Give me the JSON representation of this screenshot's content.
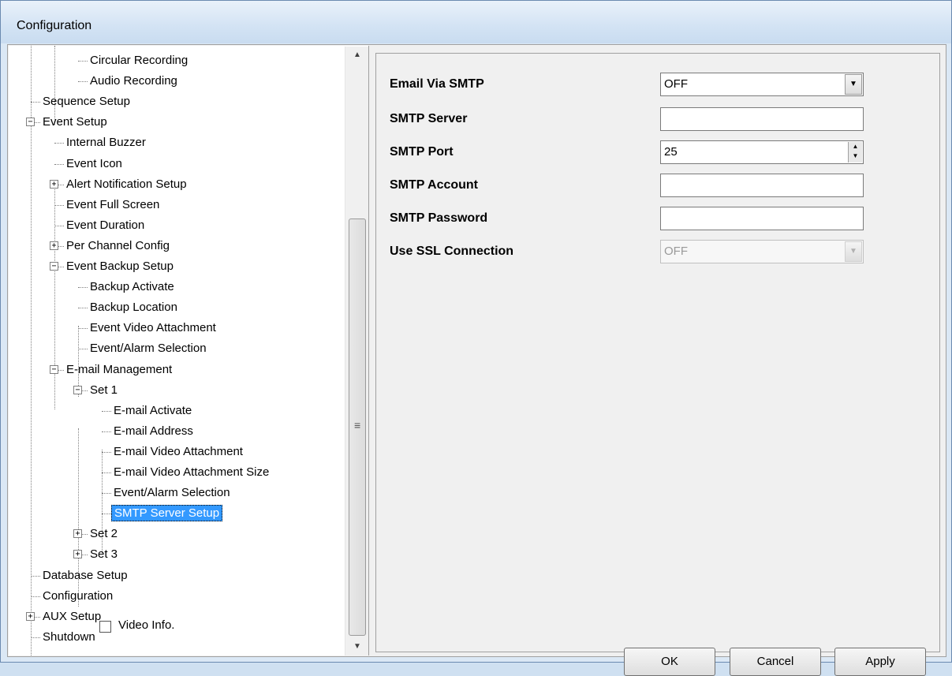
{
  "window": {
    "title": "Configuration"
  },
  "tree": {
    "items": [
      {
        "label": "Circular Recording"
      },
      {
        "label": "Audio Recording"
      },
      {
        "label": "Sequence Setup"
      },
      {
        "label": "Event Setup",
        "expander": "−"
      },
      {
        "label": "Internal Buzzer"
      },
      {
        "label": "Event Icon"
      },
      {
        "label": "Alert Notification Setup",
        "expander": "+"
      },
      {
        "label": "Event Full Screen"
      },
      {
        "label": "Event Duration"
      },
      {
        "label": "Per Channel Config",
        "expander": "+"
      },
      {
        "label": "Event Backup Setup",
        "expander": "−"
      },
      {
        "label": "Backup Activate"
      },
      {
        "label": "Backup Location"
      },
      {
        "label": "Event Video Attachment"
      },
      {
        "label": "Event/Alarm Selection"
      },
      {
        "label": "E-mail Management",
        "expander": "−"
      },
      {
        "label": "Set 1",
        "expander": "−"
      },
      {
        "label": "E-mail Activate"
      },
      {
        "label": "E-mail Address"
      },
      {
        "label": "E-mail Video Attachment"
      },
      {
        "label": "E-mail Video Attachment Size"
      },
      {
        "label": "Event/Alarm Selection"
      },
      {
        "label": "SMTP Server Setup",
        "selected": true
      },
      {
        "label": "Set 2",
        "expander": "+"
      },
      {
        "label": "Set 3",
        "expander": "+"
      },
      {
        "label": "Database Setup"
      },
      {
        "label": "Configuration"
      },
      {
        "label": "AUX Setup",
        "expander": "+"
      },
      {
        "label": "Shutdown"
      }
    ]
  },
  "form": {
    "email_via_smtp": {
      "label": "Email Via SMTP",
      "value": "OFF"
    },
    "smtp_server": {
      "label": "SMTP Server",
      "value": ""
    },
    "smtp_port": {
      "label": "SMTP Port",
      "value": "25"
    },
    "smtp_account": {
      "label": "SMTP Account",
      "value": ""
    },
    "smtp_password": {
      "label": "SMTP Password",
      "value": ""
    },
    "use_ssl": {
      "label": "Use SSL Connection",
      "value": "OFF"
    }
  },
  "video_info": {
    "label": "Video Info.",
    "checked": false
  },
  "buttons": {
    "ok": "OK",
    "cancel": "Cancel",
    "apply": "Apply"
  },
  "colors": {
    "selection": "#3399ff",
    "window_frame": "#dbe8f5"
  }
}
